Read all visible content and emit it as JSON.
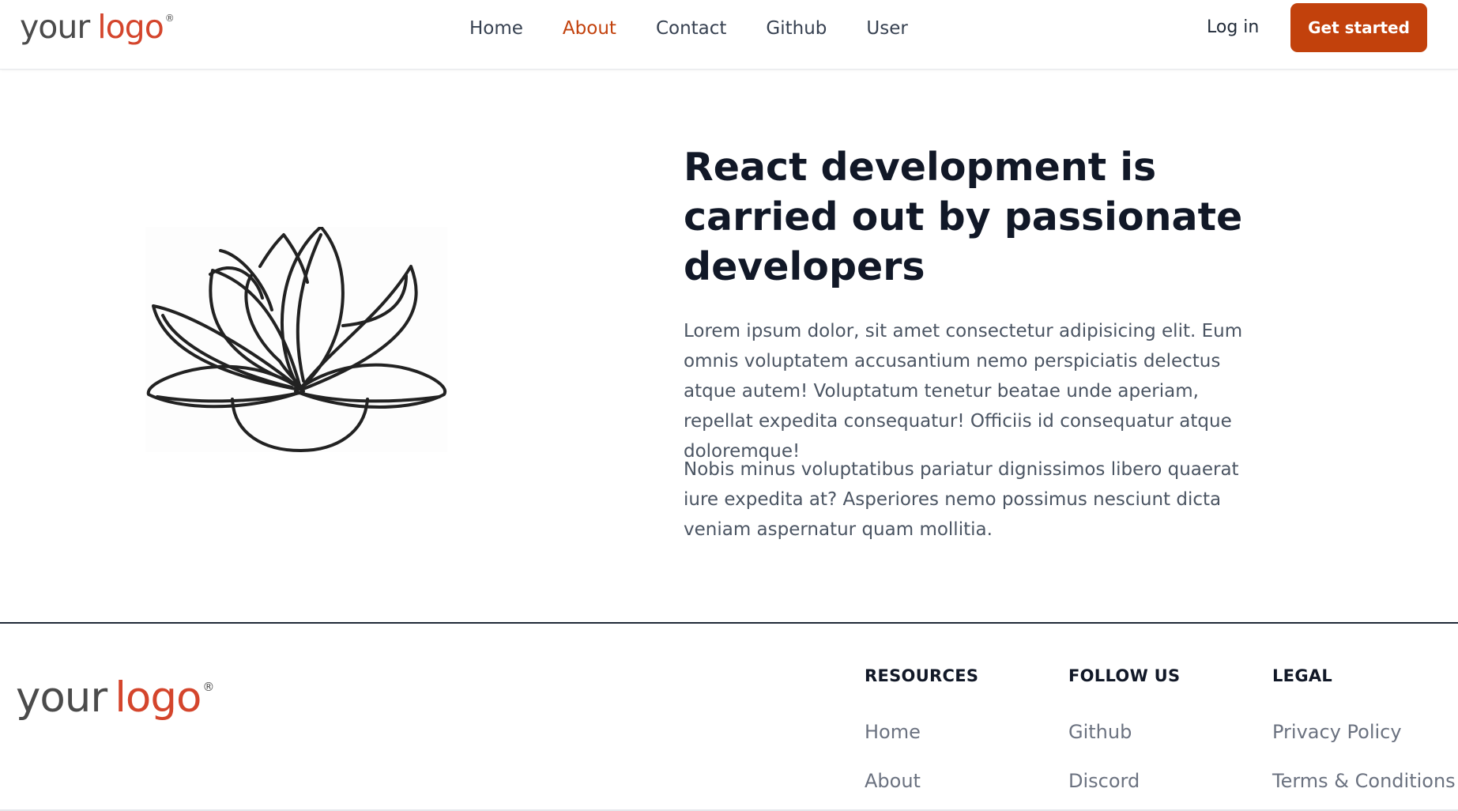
{
  "header": {
    "logo": {
      "part1": "your",
      "part2": "logo",
      "mark": "®"
    },
    "nav": [
      {
        "label": "Home",
        "active": false
      },
      {
        "label": "About",
        "active": true
      },
      {
        "label": "Contact",
        "active": false
      },
      {
        "label": "Github",
        "active": false
      },
      {
        "label": "User",
        "active": false
      }
    ],
    "login_label": "Log in",
    "cta_label": "Get started"
  },
  "main": {
    "image_icon": "lotus-icon",
    "title": "React development is carried out by passionate developers",
    "paragraphs": [
      "Lorem ipsum dolor, sit amet consectetur adipisicing elit. Eum omnis voluptatem accusantium nemo perspiciatis delectus atque autem! Voluptatum tenetur beatae unde aperiam, repellat expedita consequatur! Officiis id consequatur atque doloremque!",
      "Nobis minus voluptatibus pariatur dignissimos libero quaerat iure expedita at? Asperiores nemo possimus nesciunt dicta veniam aspernatur quam mollitia."
    ]
  },
  "footer": {
    "logo": {
      "part1": "your",
      "part2": "logo",
      "mark": "®"
    },
    "columns": [
      {
        "title": "RESOURCES",
        "links": [
          "Home",
          "About"
        ]
      },
      {
        "title": "FOLLOW US",
        "links": [
          "Github",
          "Discord"
        ]
      },
      {
        "title": "LEGAL",
        "links": [
          "Privacy Policy",
          "Terms & Conditions"
        ]
      }
    ]
  },
  "colors": {
    "accent": "#c2410c",
    "logo_red": "#d4452c",
    "logo_gray": "#4b4b4b"
  }
}
